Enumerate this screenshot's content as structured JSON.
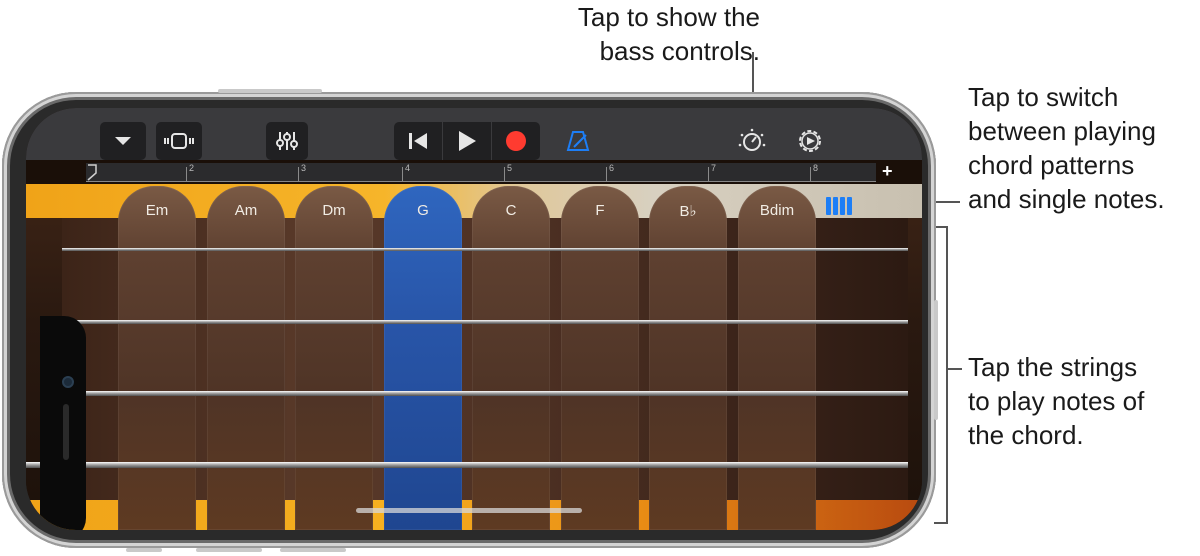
{
  "callouts": {
    "bass_controls": [
      "Tap to show the",
      "bass controls."
    ],
    "chord_mode": [
      "Tap to switch",
      "between playing",
      "chord patterns",
      "and single notes."
    ],
    "strings": [
      "Tap the strings",
      "to play notes of",
      "the chord."
    ]
  },
  "ruler": {
    "bar_numbers": [
      "2",
      "3",
      "4",
      "5",
      "6",
      "7",
      "8"
    ],
    "add_label": "+"
  },
  "chords": [
    {
      "label": "Em",
      "active": false
    },
    {
      "label": "Am",
      "active": false
    },
    {
      "label": "Dm",
      "active": false
    },
    {
      "label": "G",
      "active": true
    },
    {
      "label": "C",
      "active": false
    },
    {
      "label": "F",
      "active": false
    },
    {
      "label": "B♭",
      "active": false
    },
    {
      "label": "Bdim",
      "active": false
    }
  ],
  "icons": {
    "browser": "chevron-down-icon",
    "view": "tracks-view-icon",
    "mixer": "mixer-sliders-icon",
    "rewind": "go-to-beginning-icon",
    "play": "play-icon",
    "record": "record-icon",
    "metronome": "metronome-icon",
    "bass_controls": "knob-icon",
    "settings": "gear-icon",
    "chord_mode": "chord-strips-icon"
  },
  "colors": {
    "record": "#ff3b30",
    "accent": "#1d7ef6",
    "active_chord": "#2f66bf"
  }
}
